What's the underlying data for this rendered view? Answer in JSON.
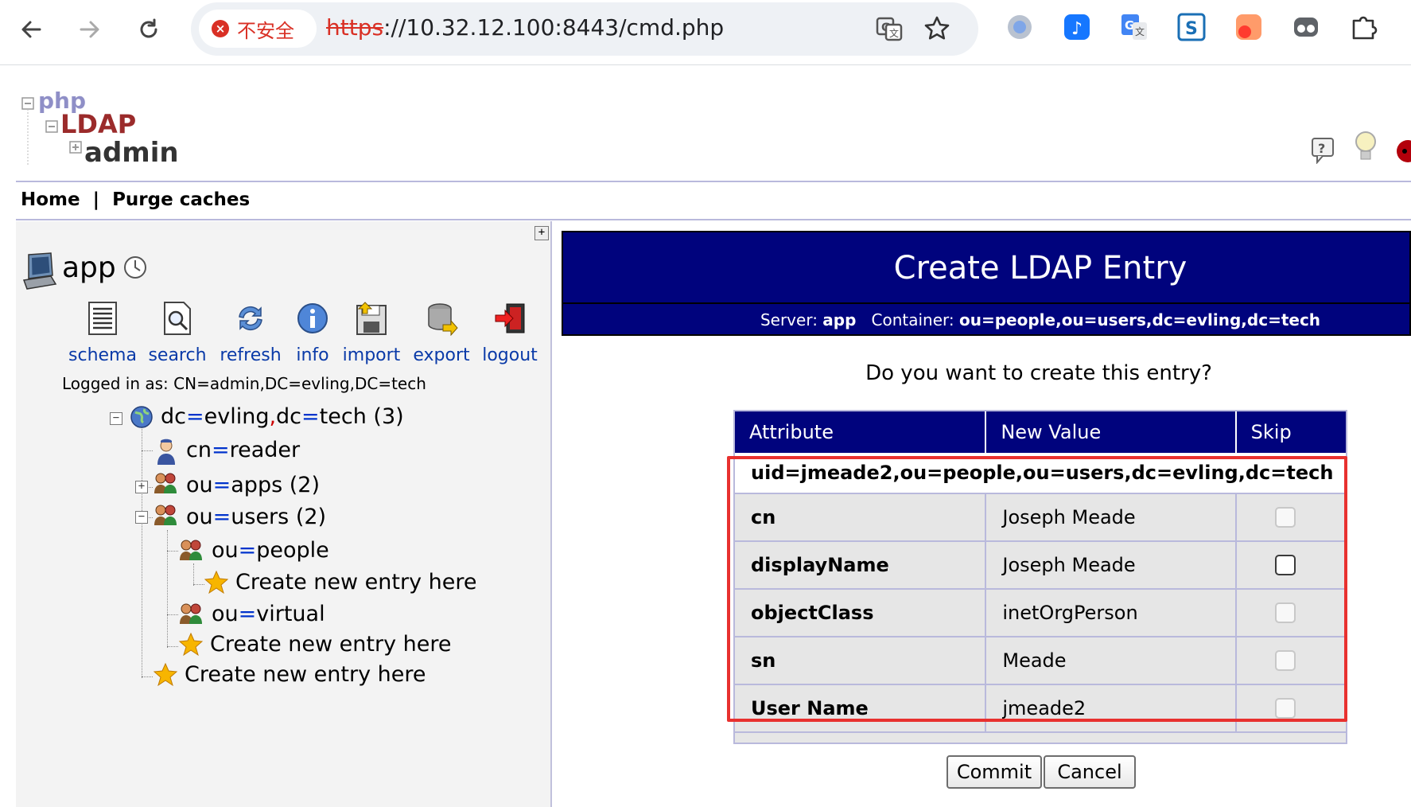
{
  "browser": {
    "security_label": "不安全",
    "url_scheme": "https",
    "url_rest": "://10.32.12.100:8443/cmd.php"
  },
  "menu": {
    "home": "Home",
    "separator": "|",
    "purge": "Purge caches"
  },
  "sidebar": {
    "server": "app",
    "tools": [
      {
        "label": "schema",
        "icon": "schema-icon"
      },
      {
        "label": "search",
        "icon": "search-icon"
      },
      {
        "label": "refresh",
        "icon": "refresh-icon"
      },
      {
        "label": "info",
        "icon": "info-icon"
      },
      {
        "label": "import",
        "icon": "import-icon"
      },
      {
        "label": "export",
        "icon": "export-icon"
      },
      {
        "label": "logout",
        "icon": "logout-icon"
      }
    ],
    "logged_in": "Logged in as: CN=admin,DC=evling,DC=tech",
    "tree": {
      "root": {
        "k1": "dc",
        "v1": "evling",
        "k2": "dc",
        "v2": "tech",
        "count": "(3)"
      },
      "reader": {
        "k": "cn",
        "v": "reader"
      },
      "apps": {
        "k": "ou",
        "v": "apps",
        "count": "(2)"
      },
      "users": {
        "k": "ou",
        "v": "users",
        "count": "(2)"
      },
      "people": {
        "k": "ou",
        "v": "people"
      },
      "create_people": "Create new entry here",
      "virtual": {
        "k": "ou",
        "v": "virtual"
      },
      "create_users": "Create new entry here",
      "create_root": "Create new entry here"
    }
  },
  "main": {
    "title": "Create LDAP Entry",
    "server_label": "Server:",
    "server_value": "app",
    "container_label": "Container:",
    "container_value": "ou=people,ou=users,dc=evling,dc=tech",
    "question": "Do you want to create this entry?",
    "table": {
      "headers": [
        "Attribute",
        "New Value",
        "Skip"
      ],
      "dn": "uid=jmeade2,ou=people,ou=users,dc=evling,dc=tech",
      "rows": [
        {
          "attr": "cn",
          "value": "Joseph Meade"
        },
        {
          "attr": "displayName",
          "value": "Joseph Meade"
        },
        {
          "attr": "objectClass",
          "value": "inetOrgPerson"
        },
        {
          "attr": "sn",
          "value": "Meade"
        },
        {
          "attr": "User Name",
          "value": "jmeade2"
        }
      ]
    },
    "commit": "Commit",
    "cancel": "Cancel"
  },
  "colors": {
    "header_blue": "#00037d",
    "highlight_red": "#e8312f",
    "link_blue": "#0a3aa8"
  }
}
